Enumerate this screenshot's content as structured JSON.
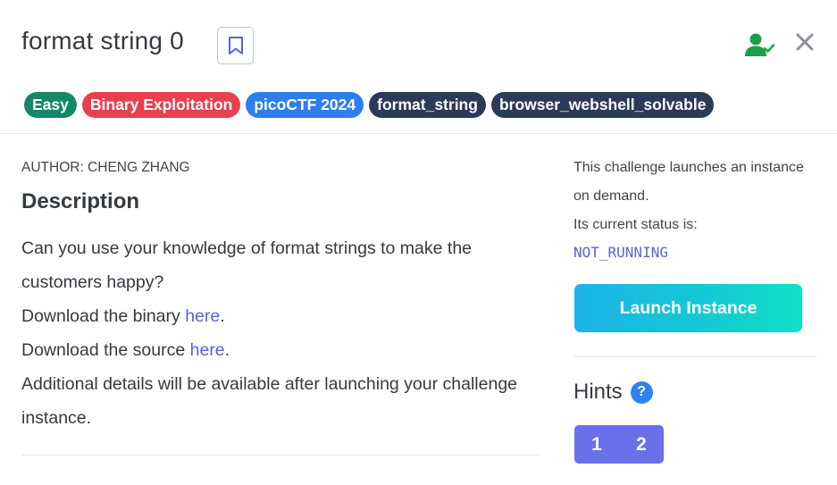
{
  "challenge": {
    "title": "format string 0",
    "tags": [
      {
        "label": "Easy",
        "color": "#148869"
      },
      {
        "label": "Binary Exploitation",
        "color": "#e8404f"
      },
      {
        "label": "picoCTF 2024",
        "color": "#2e7ef0"
      },
      {
        "label": "format_string",
        "color": "#2b3a58"
      },
      {
        "label": "browser_webshell_solvable",
        "color": "#2b3a58"
      }
    ]
  },
  "icons": {
    "bookmark": "bookmark-icon",
    "user_check": "user-check-icon",
    "close": "close-icon",
    "help": "question-icon"
  },
  "description": {
    "author": "AUTHOR: CHENG ZHANG",
    "heading": "Description",
    "line1": "Can you use your knowledge of format strings to make the customers happy?",
    "line2_prefix": "Download the binary ",
    "line2_link": "here",
    "line3_prefix": "Download the source ",
    "line3_link": "here",
    "period": ".",
    "line4": "Additional details will be available after launching your challenge instance."
  },
  "instance": {
    "intro": "This challenge launches an instance on demand.",
    "status_label": "Its current status is:",
    "status_value": "NOT_RUNNING",
    "launch_label": "Launch Instance"
  },
  "hints": {
    "heading": "Hints",
    "help_glyph": "?",
    "items": [
      "1",
      "2"
    ]
  },
  "colors": {
    "link": "#5a63d8",
    "user_check": "#1e9e4a",
    "hint_buttons": "#6a70ea",
    "help_icon": "#2f82f0"
  }
}
